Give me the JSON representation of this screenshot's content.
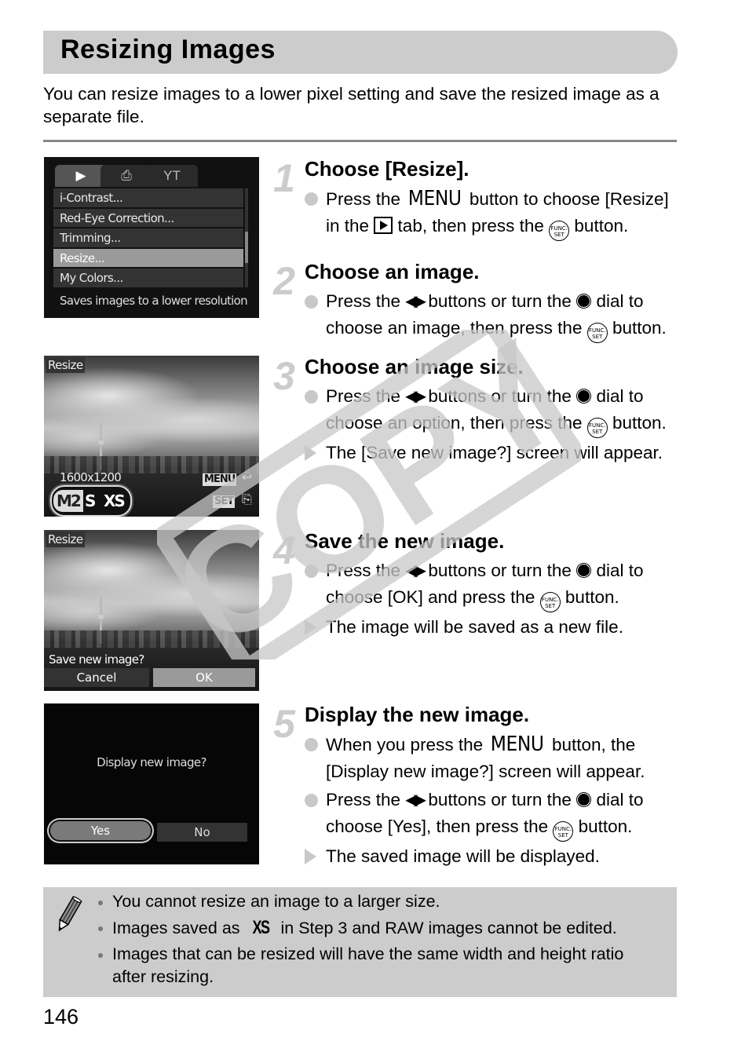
{
  "page": {
    "title": "Resizing Images",
    "intro": "You can resize images to a lower pixel setting and save the resized image as a separate file.",
    "page_number": "146",
    "watermark": "COPY"
  },
  "screens": {
    "menu": {
      "tabs": [
        {
          "icon": "playback-tab-icon",
          "glyph": "▶",
          "active": true
        },
        {
          "icon": "print-tab-icon",
          "glyph": "⎙",
          "active": false
        },
        {
          "icon": "settings-tab-icon",
          "glyph": "YT",
          "active": false
        }
      ],
      "items": [
        {
          "label": "i-Contrast...",
          "selected": false
        },
        {
          "label": "Red-Eye Correction...",
          "selected": false
        },
        {
          "label": "Trimming...",
          "selected": false
        },
        {
          "label": "Resize...",
          "selected": true
        },
        {
          "label": "My Colors...",
          "selected": false
        }
      ],
      "hint": "Saves images to a lower resolution"
    },
    "size_select": {
      "label": "Resize",
      "resolution": "1600x1200",
      "options": [
        "M2",
        "S",
        "XS"
      ],
      "selected_option": "M2",
      "menu_btn": "MENU",
      "set_btn": "SET"
    },
    "save_prompt": {
      "label": "Resize",
      "question": "Save new image?",
      "cancel": "Cancel",
      "ok": "OK",
      "selected": "OK"
    },
    "display_prompt": {
      "question": "Display new image?",
      "yes": "Yes",
      "no": "No",
      "selected": "Yes"
    }
  },
  "steps": [
    {
      "num": "1",
      "title": "Choose [Resize].",
      "bullets": [
        {
          "type": "action",
          "parts": [
            "Press the ",
            "MENU",
            " button to choose [Resize] in the ",
            "[play]",
            " tab, then press the ",
            "[func]",
            " button."
          ]
        }
      ]
    },
    {
      "num": "2",
      "title": "Choose an image.",
      "bullets": [
        {
          "type": "action",
          "parts": [
            "Press the ",
            "[arrows]",
            " buttons or turn the ",
            "[dial]",
            " dial to choose an image, then press the ",
            "[func]",
            " button."
          ]
        }
      ]
    },
    {
      "num": "3",
      "title": "Choose an image size.",
      "bullets": [
        {
          "type": "action",
          "parts": [
            "Press the ",
            "[arrows]",
            " buttons or turn the ",
            "[dial]",
            " dial to choose an option, then press the ",
            "[func]",
            " button."
          ]
        },
        {
          "type": "result",
          "parts": [
            "The [Save new image?] screen will appear."
          ]
        }
      ]
    },
    {
      "num": "4",
      "title": "Save the new image.",
      "bullets": [
        {
          "type": "action",
          "parts": [
            "Press the ",
            "[arrows]",
            " buttons or turn the ",
            "[dial]",
            " dial to choose [OK] and press the ",
            "[func]",
            " button."
          ]
        },
        {
          "type": "result",
          "parts": [
            "The image will be saved as a new file."
          ]
        }
      ]
    },
    {
      "num": "5",
      "title": "Display the new image.",
      "bullets": [
        {
          "type": "action",
          "parts": [
            "When you press the ",
            "MENU",
            " button, the [Display new image?] screen will appear."
          ]
        },
        {
          "type": "action",
          "parts": [
            "Press the ",
            "[arrows]",
            " buttons or turn the ",
            "[dial]",
            " dial to choose [Yes], then press the ",
            "[func]",
            " button."
          ]
        },
        {
          "type": "result",
          "parts": [
            "The saved image will be displayed."
          ]
        }
      ]
    }
  ],
  "icons": {
    "func_label_top": "FUNC.",
    "func_label_bottom": "SET",
    "arrows": "◀▶",
    "xs": "XS"
  },
  "notes": [
    {
      "parts": [
        "You cannot resize an image to a larger size."
      ]
    },
    {
      "parts": [
        "Images saved as ",
        "[xs]",
        " in Step 3 and RAW images cannot be edited."
      ]
    },
    {
      "parts": [
        "Images that can be resized will have the same width and height ratio after resizing."
      ]
    }
  ]
}
